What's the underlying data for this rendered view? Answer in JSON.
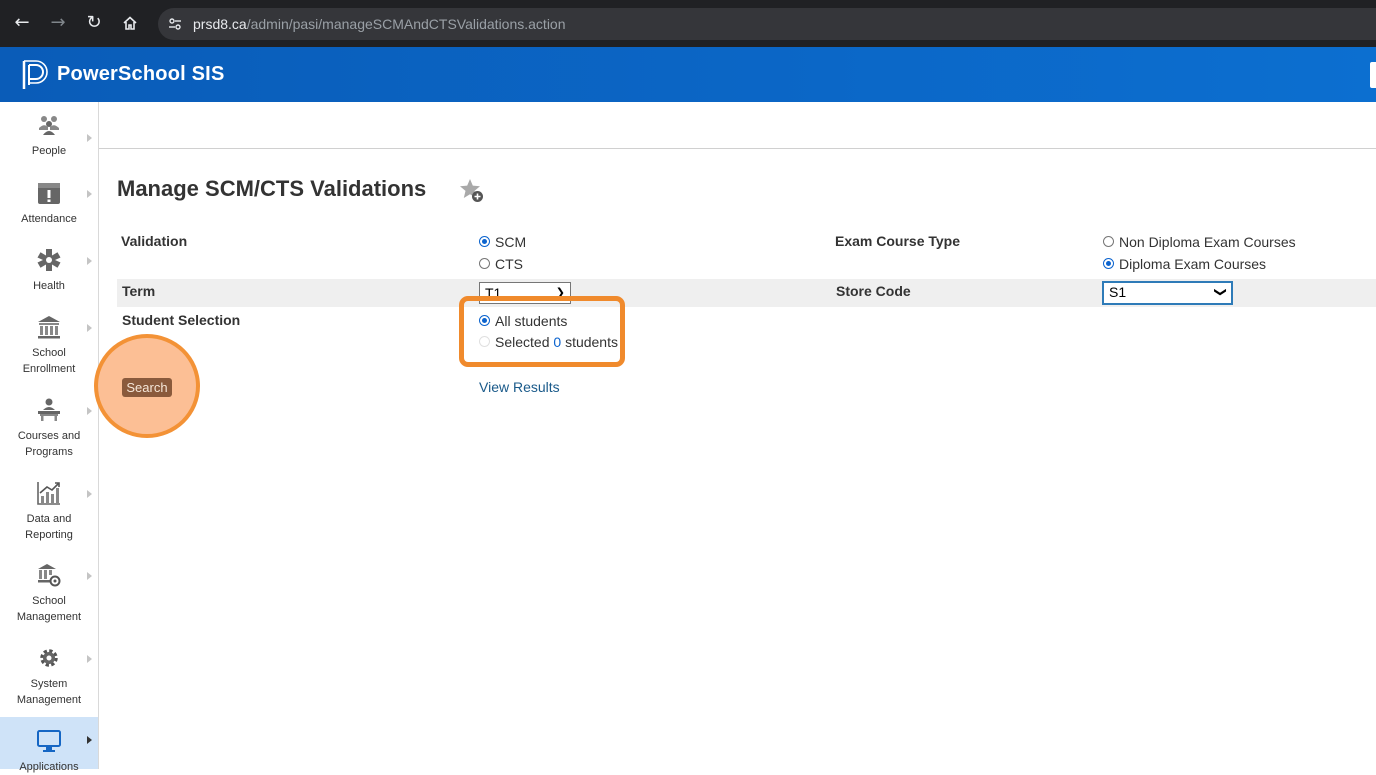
{
  "browser": {
    "url_host": "prsd8.ca",
    "url_path": "/admin/pasi/manageSCMAndCTSValidations.action",
    "icons": [
      "back-icon",
      "forward-icon",
      "reload-icon",
      "home-icon",
      "site-settings-icon"
    ]
  },
  "app": {
    "title": "PowerSchool SIS",
    "brand_color": "#0b67c7"
  },
  "sidebar": {
    "items": [
      {
        "label_line1": "People",
        "label_line2": "",
        "icon": "people-icon"
      },
      {
        "label_line1": "Attendance",
        "label_line2": "",
        "icon": "attendance-icon"
      },
      {
        "label_line1": "Health",
        "label_line2": "",
        "icon": "health-icon"
      },
      {
        "label_line1": "School",
        "label_line2": "Enrollment",
        "icon": "school-enrollment-icon"
      },
      {
        "label_line1": "Courses and",
        "label_line2": "Programs",
        "icon": "courses-icon"
      },
      {
        "label_line1": "Data and",
        "label_line2": "Reporting",
        "icon": "chart-icon"
      },
      {
        "label_line1": "School",
        "label_line2": "Management",
        "icon": "school-management-icon"
      },
      {
        "label_line1": "System",
        "label_line2": "Management",
        "icon": "gear-icon"
      },
      {
        "label_line1": "Applications",
        "label_line2": "",
        "icon": "monitor-icon",
        "active": true
      }
    ]
  },
  "page": {
    "title": "Manage SCM/CTS Validations"
  },
  "form": {
    "validation": {
      "label": "Validation",
      "options": [
        "SCM",
        "CTS"
      ],
      "selected": "SCM"
    },
    "exam_course_type": {
      "label": "Exam Course Type",
      "options": [
        "Non Diploma Exam Courses",
        "Diploma Exam Courses"
      ],
      "selected": "Diploma Exam Courses"
    },
    "term": {
      "label": "Term",
      "value": "T1"
    },
    "store_code": {
      "label": "Store Code",
      "value": "S1"
    },
    "student_selection": {
      "label": "Student Selection",
      "all_label": "All students",
      "selected_prefix": "Selected",
      "selected_count": "0",
      "selected_suffix": "students",
      "selected": "All students"
    },
    "search_label": "Search",
    "view_results_label": "View Results"
  },
  "colors": {
    "highlight": "#f08a2c",
    "radio_checked": "#0b63ce",
    "link": "#1a5a8a"
  }
}
